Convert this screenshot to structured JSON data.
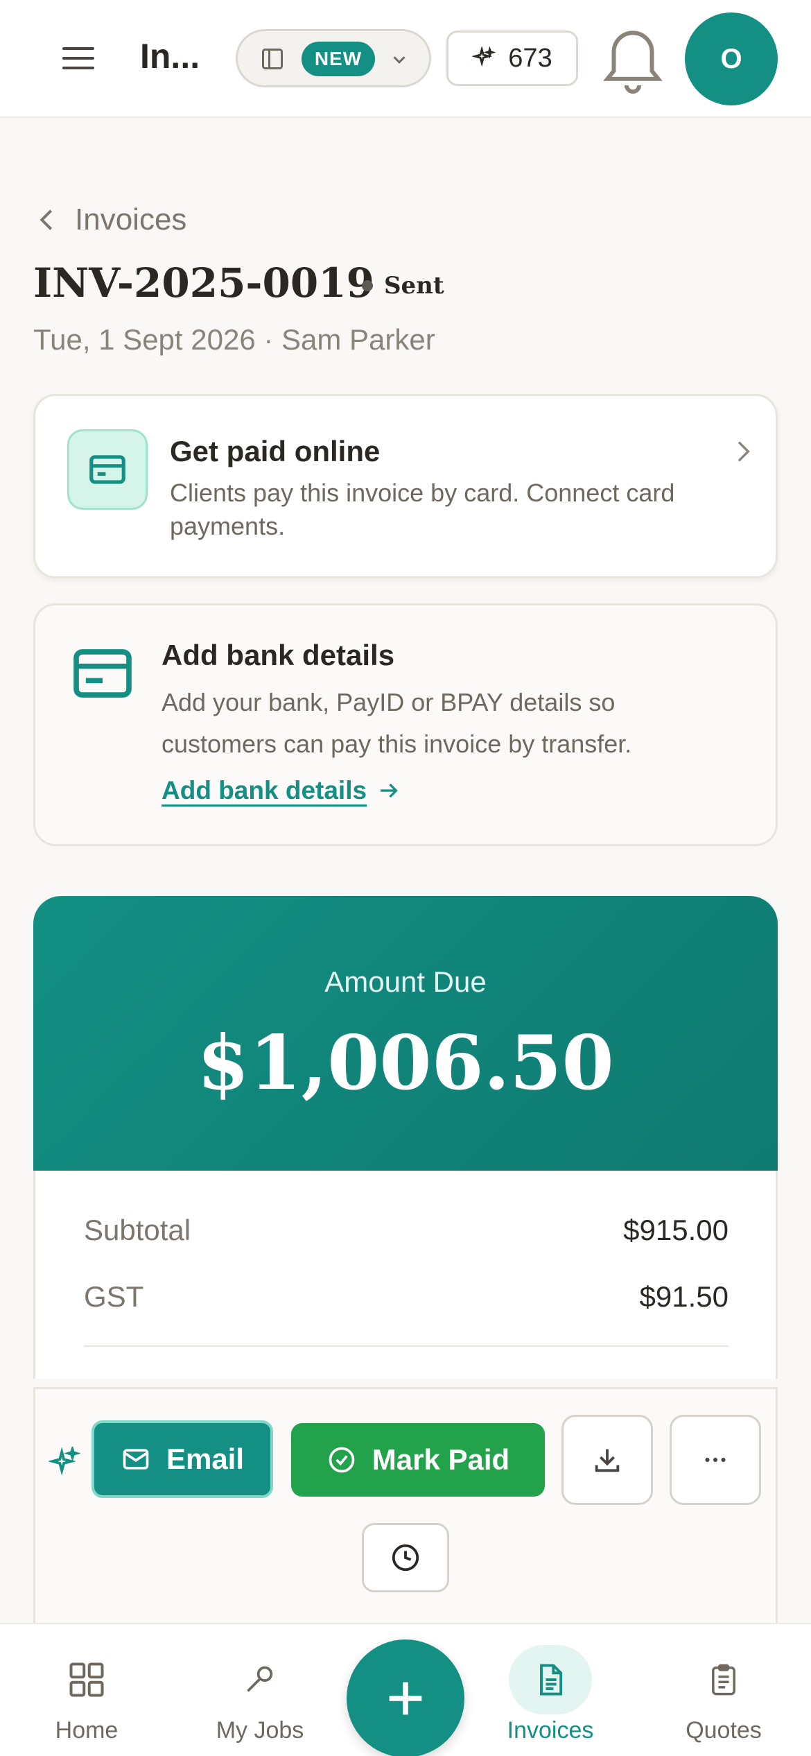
{
  "header": {
    "app_title": "In...",
    "new_badge": "NEW",
    "credits": "673",
    "avatar_initial": "O"
  },
  "invoice": {
    "back_label": "Invoices",
    "number": "INV-2025-0019",
    "status": "Sent",
    "meta": "Tue, 1 Sept 2026 · Sam Parker"
  },
  "get_paid_card": {
    "title": "Get paid online",
    "description": "Clients pay this invoice by card. Connect card payments."
  },
  "bank_card": {
    "title": "Add bank details",
    "description": "Add your bank, PayID or BPAY details so customers can pay this invoice by transfer.",
    "link": "Add bank details"
  },
  "amount": {
    "label": "Amount Due",
    "value": "$1,006.50"
  },
  "totals": [
    {
      "label": "Subtotal",
      "value": "$915.00"
    },
    {
      "label": "GST",
      "value": "$91.50"
    }
  ],
  "actions": {
    "email": "Email",
    "mark_paid": "Mark Paid"
  },
  "nav": [
    {
      "label": "Home",
      "icon": "grid-icon"
    },
    {
      "label": "My Jobs",
      "icon": "wrench-icon"
    },
    {
      "label": "Invoices",
      "icon": "document-icon"
    },
    {
      "label": "Quotes",
      "icon": "clipboard-icon"
    }
  ],
  "colors": {
    "brand": "#138f83",
    "success": "#22a24a",
    "background": "#f9f8f6"
  }
}
